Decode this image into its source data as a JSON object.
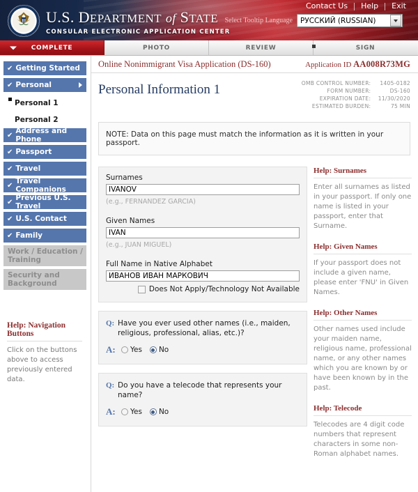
{
  "header": {
    "topnav": [
      {
        "label": "Contact Us"
      },
      {
        "label": "Help"
      },
      {
        "label": "Exit"
      }
    ],
    "agency_line1_a": "U.S. D",
    "agency_line1_b": "EPARTMENT",
    "agency_line1_c": "of",
    "agency_line1_d": "S",
    "agency_line1_e": "TATE",
    "agency_line2": "CONSULAR ELECTRONIC APPLICATION CENTER",
    "lang_label": "Select Tooltip Language",
    "lang_value": "РУССКИЙ (RUSSIAN)",
    "seal_name": "us-department-of-state-seal"
  },
  "tabs": [
    {
      "label": "COMPLETE",
      "state": "active"
    },
    {
      "label": "PHOTO",
      "state": "inactive"
    },
    {
      "label": "REVIEW",
      "state": "inactive"
    },
    {
      "label": "SIGN",
      "state": "inactive"
    }
  ],
  "appbar": {
    "form_name": "Online Nonimmigrant Visa Application (DS-160)",
    "app_id_label": "Application ID",
    "app_id_value": "AA008R73MG"
  },
  "page": {
    "title": "Personal Information 1",
    "meta": [
      {
        "label": "OMB CONTROL NUMBER:",
        "value": "1405-0182"
      },
      {
        "label": "FORM NUMBER:",
        "value": "DS-160"
      },
      {
        "label": "EXPIRATION DATE:",
        "value": "11/30/2020"
      },
      {
        "label": "ESTIMATED BURDEN:",
        "value": "75 MIN"
      }
    ],
    "note": "NOTE: Data on this page must match the information as it is written in your passport."
  },
  "sidebar": {
    "items": [
      {
        "label": "Getting Started",
        "check": "✔",
        "state": "done",
        "expandable": false
      },
      {
        "label": "Personal",
        "check": "✔",
        "state": "done",
        "expandable": true
      },
      {
        "label": "Address and Phone",
        "check": "✔",
        "state": "done",
        "expandable": false
      },
      {
        "label": "Passport",
        "check": "✔",
        "state": "done",
        "expandable": false
      },
      {
        "label": "Travel",
        "check": "✔",
        "state": "done",
        "expandable": false
      },
      {
        "label": "Travel Companions",
        "check": "✔",
        "state": "done",
        "expandable": false
      },
      {
        "label": "Previous U.S. Travel",
        "check": "✔",
        "state": "done",
        "expandable": false
      },
      {
        "label": "U.S. Contact",
        "check": "✔",
        "state": "done",
        "expandable": false
      },
      {
        "label": "Family",
        "check": "✔",
        "state": "done",
        "expandable": false
      }
    ],
    "sub_items": [
      {
        "label": "Personal 1",
        "current": true
      },
      {
        "label": "Personal 2",
        "current": false
      }
    ],
    "disabled_items": [
      {
        "label": "Work / Education / Training"
      },
      {
        "label": "Security and Background"
      }
    ],
    "help": {
      "title": "Help: Navigation Buttons",
      "body": "Click on the buttons above to access previously entered data."
    }
  },
  "form": {
    "surnames": {
      "label": "Surnames",
      "value": "IVANOV",
      "hint": "(e.g., FERNANDEZ GARCIA)"
    },
    "given_names": {
      "label": "Given Names",
      "value": "IVAN",
      "hint": "(e.g., JUAN MIGUEL)"
    },
    "native_alphabet": {
      "label": "Full Name in Native Alphabet",
      "value": "ИВАНОВ ИВАН МАРКОВИЧ",
      "checkbox_label": "Does Not Apply/Technology Not Available",
      "checkbox_checked": false
    },
    "questions": [
      {
        "q_tag": "Q:",
        "a_tag": "A:",
        "text": "Have you ever used other names (i.e., maiden, religious, professional, alias, etc.)?",
        "options": [
          {
            "label": "Yes",
            "selected": false
          },
          {
            "label": "No",
            "selected": true
          }
        ]
      },
      {
        "q_tag": "Q:",
        "a_tag": "A:",
        "text": "Do you have a telecode that represents your name?",
        "options": [
          {
            "label": "Yes",
            "selected": false
          },
          {
            "label": "No",
            "selected": true
          }
        ]
      }
    ]
  },
  "help_panel": [
    {
      "title": "Help: Surnames",
      "body": "Enter all surnames as listed in your passport. If only one name is listed in your passport, enter that Surname."
    },
    {
      "title": "Help: Given Names",
      "body": "If your passport does not include a given name, please enter 'FNU' in Given Names."
    },
    {
      "title": "Help: Other Names",
      "body": "Other names used include your maiden name, religious name, professional name, or any other names which you are known by or have been known by in the past."
    },
    {
      "title": "Help: Telecode",
      "body": "Telecodes are 4 digit code numbers that represent characters in some non-Roman alphabet names."
    }
  ],
  "colors": {
    "brand_red": "#a5141a",
    "nav_blue": "#5476ad",
    "title_blue": "#243b63",
    "help_red": "#8c2d2d"
  }
}
